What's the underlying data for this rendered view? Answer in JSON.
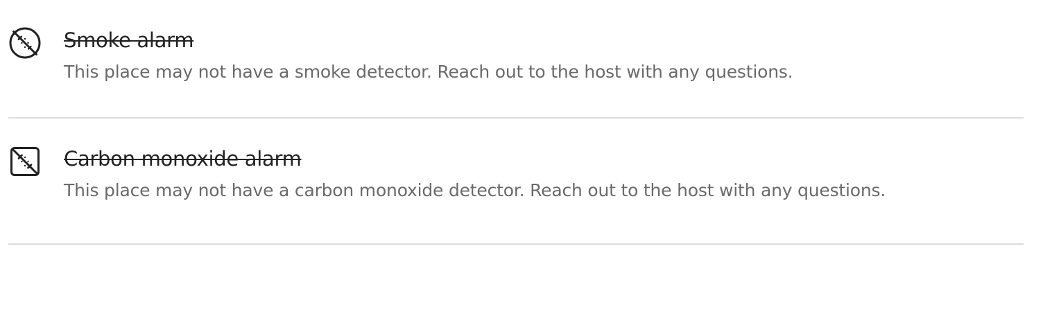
{
  "amenities_unavailable": [
    {
      "icon": "smoke-alarm-off-icon",
      "title": "Smoke alarm",
      "description": "This place may not have a smoke detector. Reach out to the host with any questions."
    },
    {
      "icon": "carbon-monoxide-alarm-off-icon",
      "title": "Carbon monoxide alarm",
      "description": "This place may not have a carbon monoxide detector. Reach out to the host with any questions."
    }
  ],
  "colors": {
    "title": "#222222",
    "description": "#6a6a6a",
    "divider": "#dddddd"
  }
}
